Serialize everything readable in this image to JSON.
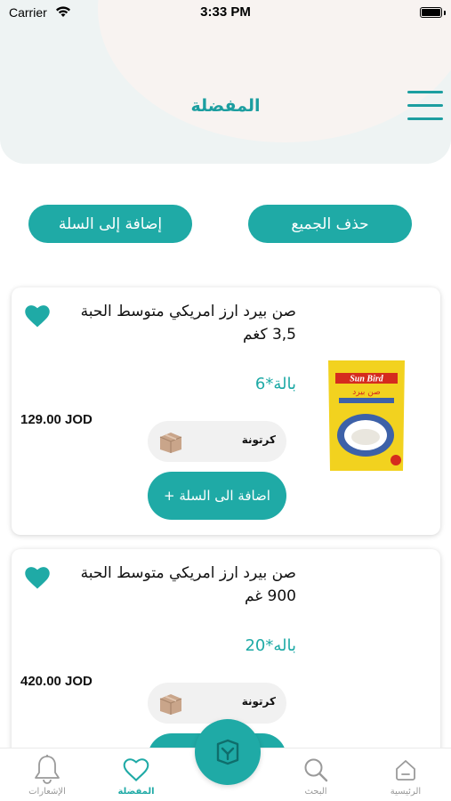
{
  "status_bar": {
    "carrier": "Carrier",
    "time": "3:33 PM"
  },
  "header": {
    "title": "المفضلة"
  },
  "actions": {
    "delete_all": "حذف الجميع",
    "add_all_to_cart": "إضافة إلى السلة"
  },
  "products": [
    {
      "name": "صن بيرد ارز امريكي متوسط الحبة 3,5 كغم",
      "quantity": "بالة*6",
      "price": "129.00 JOD",
      "unit": "كرتونة",
      "add_to_cart": "اضافة الى السلة +",
      "image_brand": "Sun Bird",
      "image_brand_ar": "صن بيرد"
    },
    {
      "name": "صن بيرد ارز امريكي متوسط الحبة 900 غم",
      "quantity": "باله*20",
      "price": "420.00 JOD",
      "unit": "كرتونة"
    }
  ],
  "tabbar": {
    "notifications": "الإشعارات",
    "favorites": "المفضلة",
    "search": "البحث",
    "home": "الرئيسية"
  },
  "colors": {
    "accent": "#1faaa6",
    "title": "#1c9ea0"
  },
  "icons": {
    "menu": "hamburger-icon",
    "favorite": "heart-icon",
    "box": "box-icon",
    "notifications": "bell-icon",
    "search": "search-icon",
    "home": "home-icon",
    "center": "app-logo-icon"
  }
}
